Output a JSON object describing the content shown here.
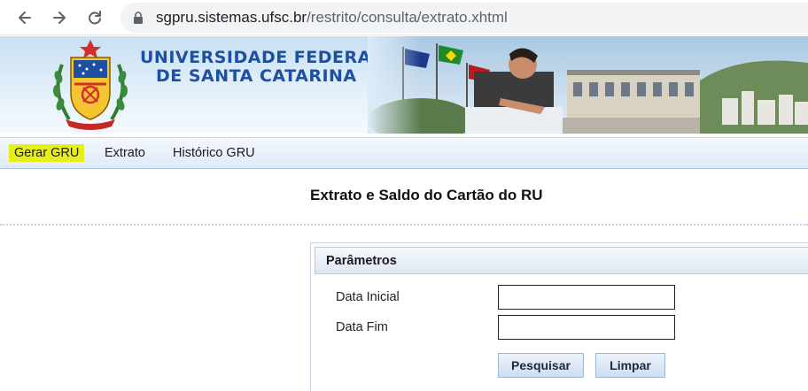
{
  "browser": {
    "url_domain": "sgpru.sistemas.ufsc.br",
    "url_path": "/restrito/consulta/extrato.xhtml",
    "icons": [
      "back-arrow-icon",
      "forward-arrow-icon",
      "reload-icon",
      "lock-icon"
    ]
  },
  "header": {
    "university_line1": "UNIVERSIDADE FEDERAL",
    "university_line2": "DE SANTA CATARINA",
    "brand_color": "#1f4fa0"
  },
  "menu": {
    "items": [
      {
        "label": "Gerar GRU",
        "highlighted": true
      },
      {
        "label": "Extrato",
        "highlighted": false
      },
      {
        "label": "Histórico GRU",
        "highlighted": false
      }
    ],
    "highlight_color": "#e6ee1b"
  },
  "page": {
    "title": "Extrato e Saldo do Cartão do RU"
  },
  "form": {
    "panel_title": "Parâmetros",
    "fields": [
      {
        "label": "Data Inicial",
        "value": ""
      },
      {
        "label": "Data Fim",
        "value": ""
      }
    ],
    "buttons": {
      "search": "Pesquisar",
      "clear": "Limpar"
    }
  }
}
